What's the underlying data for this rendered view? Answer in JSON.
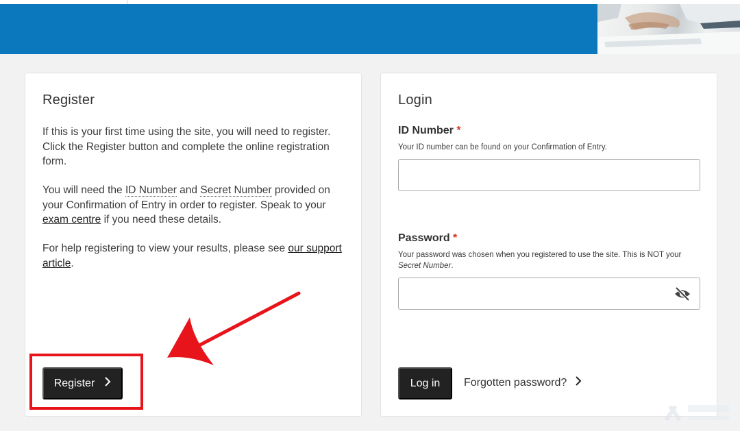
{
  "register": {
    "title": "Register",
    "p1": "If this is your first time using the site, you will need to register. Click the Register button and complete the online registration form.",
    "p2_prefix": "You will need the ",
    "p2_id_number": "ID Number",
    "p2_and": " and ",
    "p2_secret_number": "Secret Number",
    "p2_middle": " provided on your Confirmation of Entry in order to register. Speak to your ",
    "p2_link": "exam centre",
    "p2_suffix": " if you need these details.",
    "p3_prefix": "For help registering to view your results, please see ",
    "p3_link": "our support article",
    "p3_suffix": ".",
    "button_label": "Register",
    "button_icon": "chevron-right-icon"
  },
  "login": {
    "title": "Login",
    "id_label": "ID Number",
    "required_mark": "*",
    "id_hint": "Your ID number can be found on your Confirmation of Entry.",
    "id_value": "",
    "password_label": "Password",
    "password_hint_prefix": "Your password was chosen when you registered to use the site. This is NOT your ",
    "password_hint_italic": "Secret Number",
    "password_hint_suffix": ".",
    "password_value": "",
    "password_toggle_icon": "eye-slash-icon",
    "login_button": "Log in",
    "forgot_link": "Forgotten password?",
    "forgot_icon": "chevron-right-icon"
  },
  "annotation": {
    "highlight_color": "#e8141b",
    "arrow_color": "#e8141b"
  },
  "colors": {
    "banner": "#0b77bd",
    "button": "#222222",
    "required": "#d4351c"
  }
}
